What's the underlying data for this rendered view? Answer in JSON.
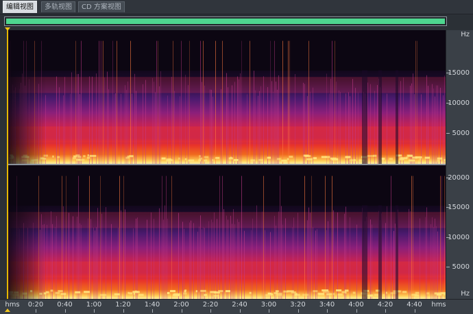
{
  "tabs": [
    {
      "label": "编辑视图",
      "active": true
    },
    {
      "label": "多轨视图",
      "active": false
    },
    {
      "label": "CD 方案视图",
      "active": false
    }
  ],
  "colors": {
    "overview_bar": "#4ed68f",
    "marker": "#f2c51a",
    "background": "#2b3036"
  },
  "freq_axis_top": {
    "unit_label": "Hz",
    "ticks": [
      "15000",
      "10000",
      "5000"
    ]
  },
  "freq_axis_bottom": {
    "unit_label": "Hz",
    "ticks": [
      "20000",
      "15000",
      "10000",
      "5000"
    ]
  },
  "time_axis": {
    "unit_left": "hms",
    "unit_right": "hms",
    "ticks": [
      "0:20",
      "0:40",
      "1:00",
      "1:20",
      "1:40",
      "2:00",
      "2:20",
      "2:40",
      "3:00",
      "3:20",
      "3:40",
      "4:00",
      "4:20",
      "4:40"
    ]
  }
}
